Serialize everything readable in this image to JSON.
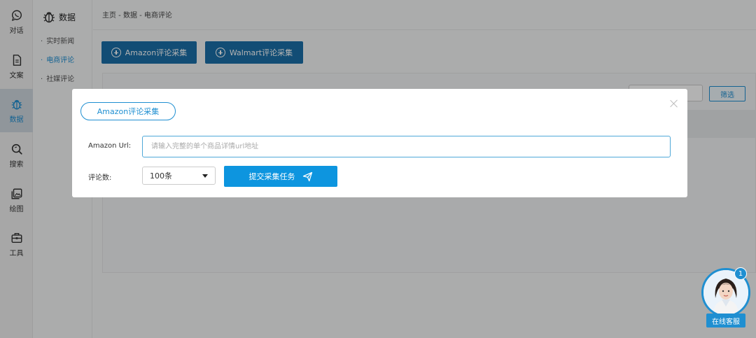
{
  "rail": {
    "items": [
      {
        "label": "对话",
        "icon": "chat-icon"
      },
      {
        "label": "文案",
        "icon": "document-icon"
      },
      {
        "label": "数据",
        "icon": "data-bug-icon",
        "active": true
      },
      {
        "label": "搜索",
        "icon": "search-icon"
      },
      {
        "label": "绘图",
        "icon": "image-icon"
      },
      {
        "label": "工具",
        "icon": "toolbox-icon"
      }
    ]
  },
  "submenu": {
    "title": "数据",
    "items": [
      {
        "label": "实时新闻"
      },
      {
        "label": "电商评论",
        "active": true
      },
      {
        "label": "社媒评论"
      }
    ]
  },
  "breadcrumb": "主页 - 数据 - 电商评论",
  "toolbar": {
    "amazon_label": "Amazon评论采集",
    "walmart_label": "Walmart评论采集"
  },
  "filter": {
    "label": "筛选"
  },
  "modal": {
    "title": "Amazon评论采集",
    "url_label": "Amazon Url:",
    "url_placeholder": "请输入完整的单个商品详情url地址",
    "count_label": "评论数:",
    "count_value": "100条",
    "submit_label": "提交采集任务"
  },
  "customer_service": {
    "label": "在线客服",
    "badge": "1"
  },
  "colors": {
    "accent": "#1f8fd1",
    "primary_button": "#1b6fa8",
    "submit_button": "#0d95df"
  }
}
